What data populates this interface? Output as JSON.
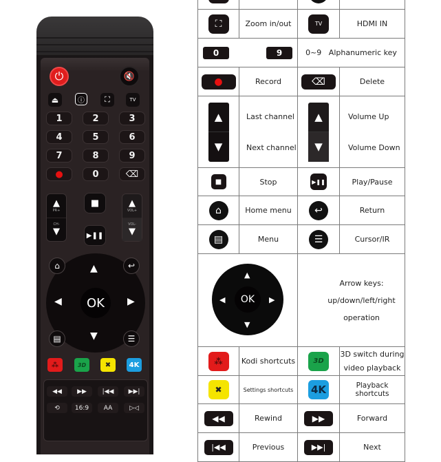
{
  "remote": {
    "top_row": {
      "power_icon": "⏻",
      "mute_icon": "🔇"
    },
    "function_row": [
      {
        "name": "eject",
        "glyph": "⏏"
      },
      {
        "name": "info",
        "glyph": "ⓘ"
      },
      {
        "name": "zoom",
        "glyph": "⛶"
      },
      {
        "name": "tv",
        "glyph": "TV"
      }
    ],
    "number_keys": [
      "1",
      "2",
      "3",
      "4",
      "5",
      "6",
      "7",
      "8",
      "9"
    ],
    "bottom_keys": {
      "record": "●",
      "zero": "0",
      "delete": "⌫"
    },
    "channel_rocker": {
      "up": "▲",
      "down": "▼",
      "up_label": "PR+",
      "down_label": "CH-"
    },
    "volume_rocker": {
      "up": "▲",
      "down": "▼",
      "up_label": "VOL+",
      "down_label": "VOL-"
    },
    "stop": "■",
    "play_pause": "▶❚❚",
    "dpad": {
      "ok": "OK",
      "up": "▲",
      "down": "▼",
      "left": "◀",
      "right": "▶"
    },
    "corners": {
      "home": "⌂",
      "return": "↩",
      "menu": "▤",
      "cursor": "☰"
    },
    "color_keys": [
      {
        "name": "kodi",
        "label": "⁂",
        "color": "#e21b1b"
      },
      {
        "name": "3d",
        "label": "3D",
        "color": "#1aa34a"
      },
      {
        "name": "settings",
        "label": "✖",
        "color": "#f5e400"
      },
      {
        "name": "4k",
        "label": "4K",
        "color": "#1c9ee0"
      }
    ],
    "media_row1": [
      "◀◀",
      "▶▶",
      "|◀◀",
      "▶▶|"
    ],
    "media_row2": [
      "⟲",
      "16:9",
      "AA",
      "▷◁"
    ]
  },
  "legend": {
    "rows": [
      {
        "left_icon": "",
        "left_label": "",
        "right_icon": "",
        "right_label": ""
      },
      {
        "left_icon": "⛶",
        "left_label": "Zoom in/out",
        "right_icon": "TV",
        "right_label": "HDMI IN"
      },
      {
        "left_key": "0",
        "right_key": "9",
        "label": "0~9   Alphanumeric key"
      },
      {
        "left_icon": "●",
        "left_label": "Record",
        "right_icon": "⌫",
        "right_label": "Delete"
      },
      {
        "left_labels": [
          "Last channel",
          "Next channel"
        ],
        "right_labels": [
          "Volume Up",
          "Volume Down"
        ]
      },
      {
        "left_icon": "■",
        "left_label": "Stop",
        "right_icon": "▶❚❚",
        "right_label": "Play/Pause"
      },
      {
        "left_icon": "⌂",
        "left_label": "Home menu",
        "right_icon": "↩",
        "right_label": "Return"
      },
      {
        "left_icon": "▤",
        "left_label": "Menu",
        "right_icon": "☰",
        "right_label": "Cursor/IR"
      },
      {
        "dpad_ok": "OK",
        "lines": [
          "Arrow keys:",
          "up/down/left/right",
          "operation"
        ]
      },
      {
        "left_icon": "⁂",
        "left_label": "Kodi shortcuts",
        "right_icon": "3D",
        "right_label": "3D switch during video playback"
      },
      {
        "left_icon": "✖",
        "left_label": "Settings shortcuts",
        "right_icon": "4K",
        "right_label": "Playback shortcuts"
      },
      {
        "left_icon": "◀◀",
        "left_label": "Rewind",
        "right_icon": "▶▶",
        "right_label": "Forward"
      },
      {
        "left_icon": "|◀◀",
        "left_label": "Previous",
        "right_icon": "▶▶|",
        "right_label": "Next"
      }
    ],
    "colors": {
      "kodi": "#e21b1b",
      "3d": "#1aa34a",
      "settings": "#f5e400",
      "4k": "#1c9ee0",
      "record": "#e61010"
    }
  }
}
